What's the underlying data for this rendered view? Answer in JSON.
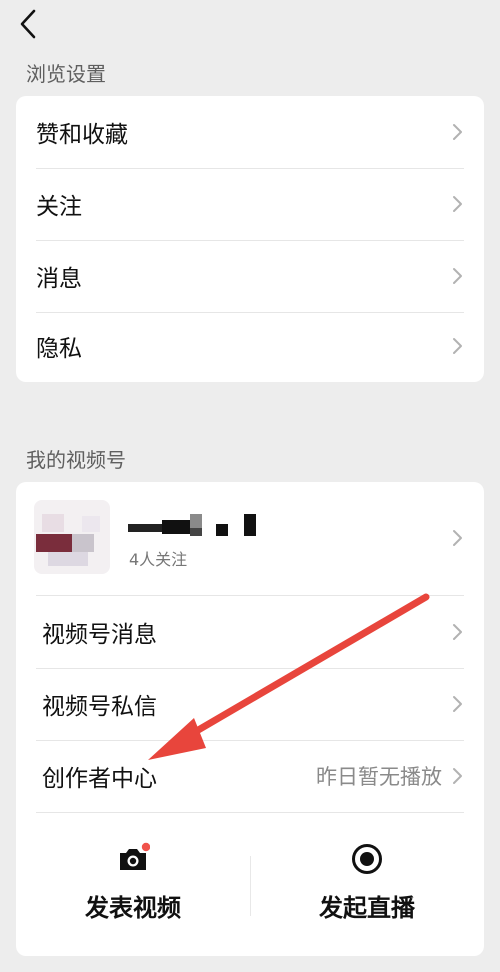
{
  "browse_settings": {
    "title": "浏览设置",
    "items": [
      {
        "label": "赞和收藏"
      },
      {
        "label": "关注"
      },
      {
        "label": "消息"
      },
      {
        "label": "隐私"
      }
    ]
  },
  "channels": {
    "title": "我的视频号",
    "profile": {
      "followers": "4人关注"
    },
    "items": [
      {
        "label": "视频号消息",
        "value": ""
      },
      {
        "label": "视频号私信",
        "value": ""
      },
      {
        "label": "创作者中心",
        "value": "昨日暂无播放"
      }
    ],
    "actions": {
      "post_video": "发表视频",
      "go_live": "发起直播"
    }
  },
  "colors": {
    "accent_arrow": "#e8453c",
    "notification_dot": "#f0524b"
  }
}
